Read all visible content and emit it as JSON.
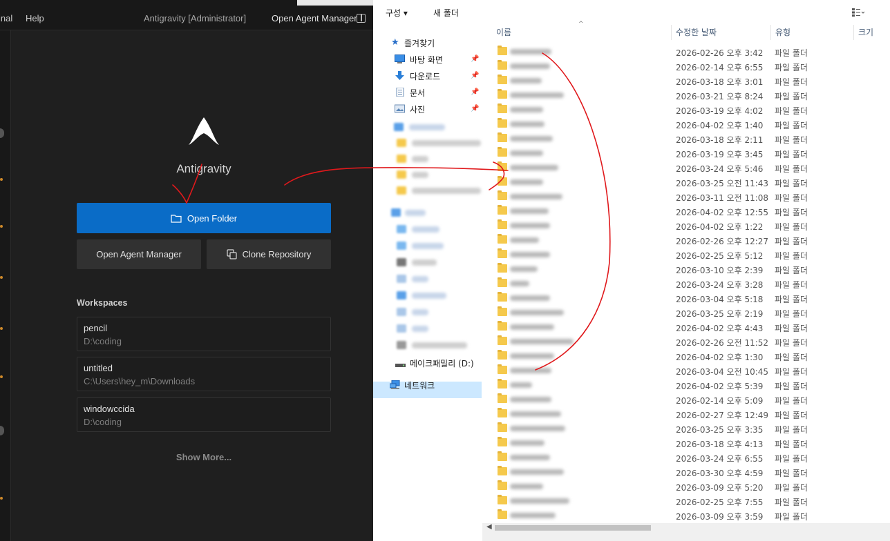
{
  "app": {
    "menu": [
      "inal",
      "Help"
    ],
    "window_title": "Antigravity [Administrator]",
    "agent_manager_title": "Open Agent Manager",
    "name": "Antigravity",
    "buttons": {
      "open_folder": "Open Folder",
      "open_agent_manager": "Open Agent Manager",
      "clone_repository": "Clone Repository"
    },
    "workspaces_title": "Workspaces",
    "workspaces": [
      {
        "name": "pencil",
        "path": "D:\\coding"
      },
      {
        "name": "untitled",
        "path": "C:\\Users\\hey_m\\Downloads"
      },
      {
        "name": "windowccida",
        "path": "D:\\coding"
      }
    ],
    "show_more": "Show More..."
  },
  "explorer": {
    "toolbar": {
      "organize": "구성",
      "new_folder": "새 폴더"
    },
    "nav": {
      "favorites": "즐겨찾기",
      "desktop": "바탕 화면",
      "downloads": "다운로드",
      "documents": "문서",
      "pictures": "사진",
      "drive": "메이크패밀리 (D:)",
      "network": "네트워크"
    },
    "columns": {
      "name": "이름",
      "date": "수정한 날짜",
      "type": "유형",
      "size": "크기"
    },
    "files": [
      {
        "date": "2026-02-26 오후 3:42",
        "type": "파일 폴더"
      },
      {
        "date": "2026-02-14 오후 6:55",
        "type": "파일 폴더"
      },
      {
        "date": "2026-03-18 오후 3:01",
        "type": "파일 폴더"
      },
      {
        "date": "2026-03-21 오후 8:24",
        "type": "파일 폴더"
      },
      {
        "date": "2026-03-19 오후 4:02",
        "type": "파일 폴더"
      },
      {
        "date": "2026-04-02 오후 1:40",
        "type": "파일 폴더"
      },
      {
        "date": "2026-03-18 오후 2:11",
        "type": "파일 폴더"
      },
      {
        "date": "2026-03-19 오후 3:45",
        "type": "파일 폴더"
      },
      {
        "date": "2026-03-24 오후 5:46",
        "type": "파일 폴더"
      },
      {
        "date": "2026-03-25 오전 11:43",
        "type": "파일 폴더"
      },
      {
        "date": "2026-03-11 오전 11:08",
        "type": "파일 폴더"
      },
      {
        "date": "2026-04-02 오후 12:55",
        "type": "파일 폴더"
      },
      {
        "date": "2026-04-02 오후 1:22",
        "type": "파일 폴더"
      },
      {
        "date": "2026-02-26 오후 12:27",
        "type": "파일 폴더"
      },
      {
        "date": "2026-02-25 오후 5:12",
        "type": "파일 폴더"
      },
      {
        "date": "2026-03-10 오후 2:39",
        "type": "파일 폴더"
      },
      {
        "date": "2026-03-24 오후 3:28",
        "type": "파일 폴더"
      },
      {
        "date": "2026-03-04 오후 5:18",
        "type": "파일 폴더"
      },
      {
        "date": "2026-03-25 오후 2:19",
        "type": "파일 폴더"
      },
      {
        "date": "2026-04-02 오후 4:43",
        "type": "파일 폴더"
      },
      {
        "date": "2026-02-26 오전 11:52",
        "type": "파일 폴더"
      },
      {
        "date": "2026-04-02 오후 1:30",
        "type": "파일 폴더"
      },
      {
        "date": "2026-03-04 오전 10:45",
        "type": "파일 폴더"
      },
      {
        "date": "2026-04-02 오후 5:39",
        "type": "파일 폴더"
      },
      {
        "date": "2026-02-14 오후 5:09",
        "type": "파일 폴더"
      },
      {
        "date": "2026-02-27 오후 12:49",
        "type": "파일 폴더"
      },
      {
        "date": "2026-03-25 오후 3:35",
        "type": "파일 폴더"
      },
      {
        "date": "2026-03-18 오후 4:13",
        "type": "파일 폴더"
      },
      {
        "date": "2026-03-24 오후 6:55",
        "type": "파일 폴더"
      },
      {
        "date": "2026-03-30 오후 4:59",
        "type": "파일 폴더"
      },
      {
        "date": "2026-03-09 오후 5:20",
        "type": "파일 폴더"
      },
      {
        "date": "2026-02-25 오후 7:55",
        "type": "파일 폴더"
      },
      {
        "date": "2026-03-09 오후 3:59",
        "type": "파일 폴더"
      }
    ]
  },
  "colors": {
    "primary_button": "#0a6cc7",
    "annotation": "#e0191c",
    "folder": "#f5c94c",
    "nav_selected": "#cce8ff"
  },
  "icons": [
    "antigravity-logo-icon",
    "folder-icon",
    "clone-icon",
    "layout-icon",
    "star-icon",
    "desktop-icon",
    "download-icon",
    "document-icon",
    "picture-icon",
    "drive-icon",
    "network-icon",
    "pin-icon",
    "view-options-icon",
    "sort-arrow-icon"
  ]
}
